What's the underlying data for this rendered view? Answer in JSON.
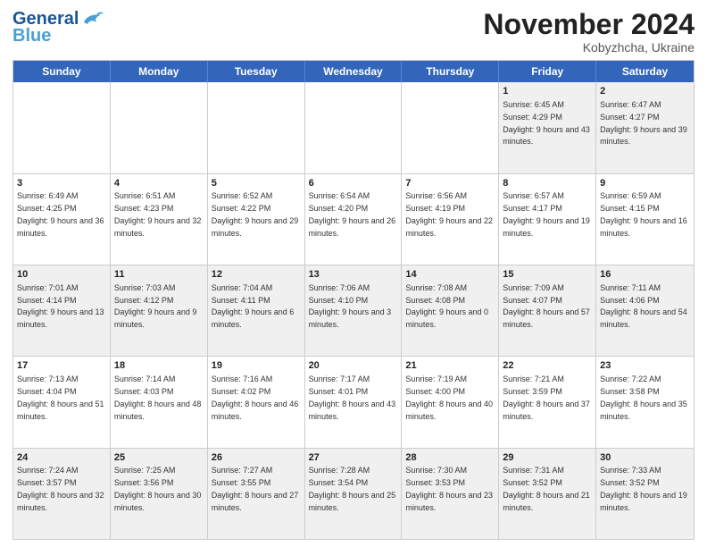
{
  "header": {
    "logo_line1": "General",
    "logo_line2": "Blue",
    "month": "November 2024",
    "location": "Kobyzhcha, Ukraine"
  },
  "days_of_week": [
    "Sunday",
    "Monday",
    "Tuesday",
    "Wednesday",
    "Thursday",
    "Friday",
    "Saturday"
  ],
  "rows": [
    [
      {
        "day": "",
        "info": ""
      },
      {
        "day": "",
        "info": ""
      },
      {
        "day": "",
        "info": ""
      },
      {
        "day": "",
        "info": ""
      },
      {
        "day": "",
        "info": ""
      },
      {
        "day": "1",
        "info": "Sunrise: 6:45 AM\nSunset: 4:29 PM\nDaylight: 9 hours and 43 minutes."
      },
      {
        "day": "2",
        "info": "Sunrise: 6:47 AM\nSunset: 4:27 PM\nDaylight: 9 hours and 39 minutes."
      }
    ],
    [
      {
        "day": "3",
        "info": "Sunrise: 6:49 AM\nSunset: 4:25 PM\nDaylight: 9 hours and 36 minutes."
      },
      {
        "day": "4",
        "info": "Sunrise: 6:51 AM\nSunset: 4:23 PM\nDaylight: 9 hours and 32 minutes."
      },
      {
        "day": "5",
        "info": "Sunrise: 6:52 AM\nSunset: 4:22 PM\nDaylight: 9 hours and 29 minutes."
      },
      {
        "day": "6",
        "info": "Sunrise: 6:54 AM\nSunset: 4:20 PM\nDaylight: 9 hours and 26 minutes."
      },
      {
        "day": "7",
        "info": "Sunrise: 6:56 AM\nSunset: 4:19 PM\nDaylight: 9 hours and 22 minutes."
      },
      {
        "day": "8",
        "info": "Sunrise: 6:57 AM\nSunset: 4:17 PM\nDaylight: 9 hours and 19 minutes."
      },
      {
        "day": "9",
        "info": "Sunrise: 6:59 AM\nSunset: 4:15 PM\nDaylight: 9 hours and 16 minutes."
      }
    ],
    [
      {
        "day": "10",
        "info": "Sunrise: 7:01 AM\nSunset: 4:14 PM\nDaylight: 9 hours and 13 minutes."
      },
      {
        "day": "11",
        "info": "Sunrise: 7:03 AM\nSunset: 4:12 PM\nDaylight: 9 hours and 9 minutes."
      },
      {
        "day": "12",
        "info": "Sunrise: 7:04 AM\nSunset: 4:11 PM\nDaylight: 9 hours and 6 minutes."
      },
      {
        "day": "13",
        "info": "Sunrise: 7:06 AM\nSunset: 4:10 PM\nDaylight: 9 hours and 3 minutes."
      },
      {
        "day": "14",
        "info": "Sunrise: 7:08 AM\nSunset: 4:08 PM\nDaylight: 9 hours and 0 minutes."
      },
      {
        "day": "15",
        "info": "Sunrise: 7:09 AM\nSunset: 4:07 PM\nDaylight: 8 hours and 57 minutes."
      },
      {
        "day": "16",
        "info": "Sunrise: 7:11 AM\nSunset: 4:06 PM\nDaylight: 8 hours and 54 minutes."
      }
    ],
    [
      {
        "day": "17",
        "info": "Sunrise: 7:13 AM\nSunset: 4:04 PM\nDaylight: 8 hours and 51 minutes."
      },
      {
        "day": "18",
        "info": "Sunrise: 7:14 AM\nSunset: 4:03 PM\nDaylight: 8 hours and 48 minutes."
      },
      {
        "day": "19",
        "info": "Sunrise: 7:16 AM\nSunset: 4:02 PM\nDaylight: 8 hours and 46 minutes."
      },
      {
        "day": "20",
        "info": "Sunrise: 7:17 AM\nSunset: 4:01 PM\nDaylight: 8 hours and 43 minutes."
      },
      {
        "day": "21",
        "info": "Sunrise: 7:19 AM\nSunset: 4:00 PM\nDaylight: 8 hours and 40 minutes."
      },
      {
        "day": "22",
        "info": "Sunrise: 7:21 AM\nSunset: 3:59 PM\nDaylight: 8 hours and 37 minutes."
      },
      {
        "day": "23",
        "info": "Sunrise: 7:22 AM\nSunset: 3:58 PM\nDaylight: 8 hours and 35 minutes."
      }
    ],
    [
      {
        "day": "24",
        "info": "Sunrise: 7:24 AM\nSunset: 3:57 PM\nDaylight: 8 hours and 32 minutes."
      },
      {
        "day": "25",
        "info": "Sunrise: 7:25 AM\nSunset: 3:56 PM\nDaylight: 8 hours and 30 minutes."
      },
      {
        "day": "26",
        "info": "Sunrise: 7:27 AM\nSunset: 3:55 PM\nDaylight: 8 hours and 27 minutes."
      },
      {
        "day": "27",
        "info": "Sunrise: 7:28 AM\nSunset: 3:54 PM\nDaylight: 8 hours and 25 minutes."
      },
      {
        "day": "28",
        "info": "Sunrise: 7:30 AM\nSunset: 3:53 PM\nDaylight: 8 hours and 23 minutes."
      },
      {
        "day": "29",
        "info": "Sunrise: 7:31 AM\nSunset: 3:52 PM\nDaylight: 8 hours and 21 minutes."
      },
      {
        "day": "30",
        "info": "Sunrise: 7:33 AM\nSunset: 3:52 PM\nDaylight: 8 hours and 19 minutes."
      }
    ]
  ]
}
